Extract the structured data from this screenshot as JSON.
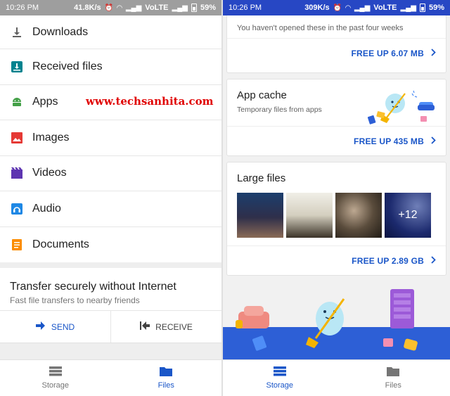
{
  "left": {
    "status": {
      "time": "10:26 PM",
      "speed": "41.8K/s",
      "network": "VoLTE",
      "battery": "59%"
    },
    "categories": [
      {
        "label": "Downloads",
        "icon": "download-icon",
        "color": "#616161"
      },
      {
        "label": "Received files",
        "icon": "received-files-icon",
        "color": "#00838f"
      },
      {
        "label": "Apps",
        "icon": "android-icon",
        "color": "#43a047"
      },
      {
        "label": "Images",
        "icon": "image-icon",
        "color": "#e53935"
      },
      {
        "label": "Videos",
        "icon": "video-icon",
        "color": "#5e35b1"
      },
      {
        "label": "Audio",
        "icon": "headphones-icon",
        "color": "#1e88e5"
      },
      {
        "label": "Documents",
        "icon": "document-icon",
        "color": "#fb8c00"
      }
    ],
    "watermark": "www.techsanhita.com",
    "transfer": {
      "title": "Transfer securely without Internet",
      "subtitle": "Fast file transfers to nearby friends",
      "send_label": "SEND",
      "receive_label": "RECEIVE"
    },
    "nav": {
      "storage": "Storage",
      "files": "Files",
      "active": "files"
    }
  },
  "right": {
    "status": {
      "time": "10:26 PM",
      "speed": "309K/s",
      "network": "VoLTE",
      "battery": "59%"
    },
    "top_card": {
      "description": "You haven't opened these in the past four weeks",
      "action": "FREE UP 6.07 MB"
    },
    "app_cache": {
      "title": "App cache",
      "subtitle": "Temporary files from apps",
      "action": "FREE UP 435 MB"
    },
    "large_files": {
      "title": "Large files",
      "more_count": "+12",
      "action": "FREE UP 2.89 GB"
    },
    "nav": {
      "storage": "Storage",
      "files": "Files",
      "active": "storage"
    }
  },
  "colors": {
    "accent": "#1a56c8",
    "right_status_bar": "#2747c4",
    "left_status_bar": "#9e9e9e",
    "watermark": "#e00000",
    "illustration_floor": "#2d5fd6"
  }
}
